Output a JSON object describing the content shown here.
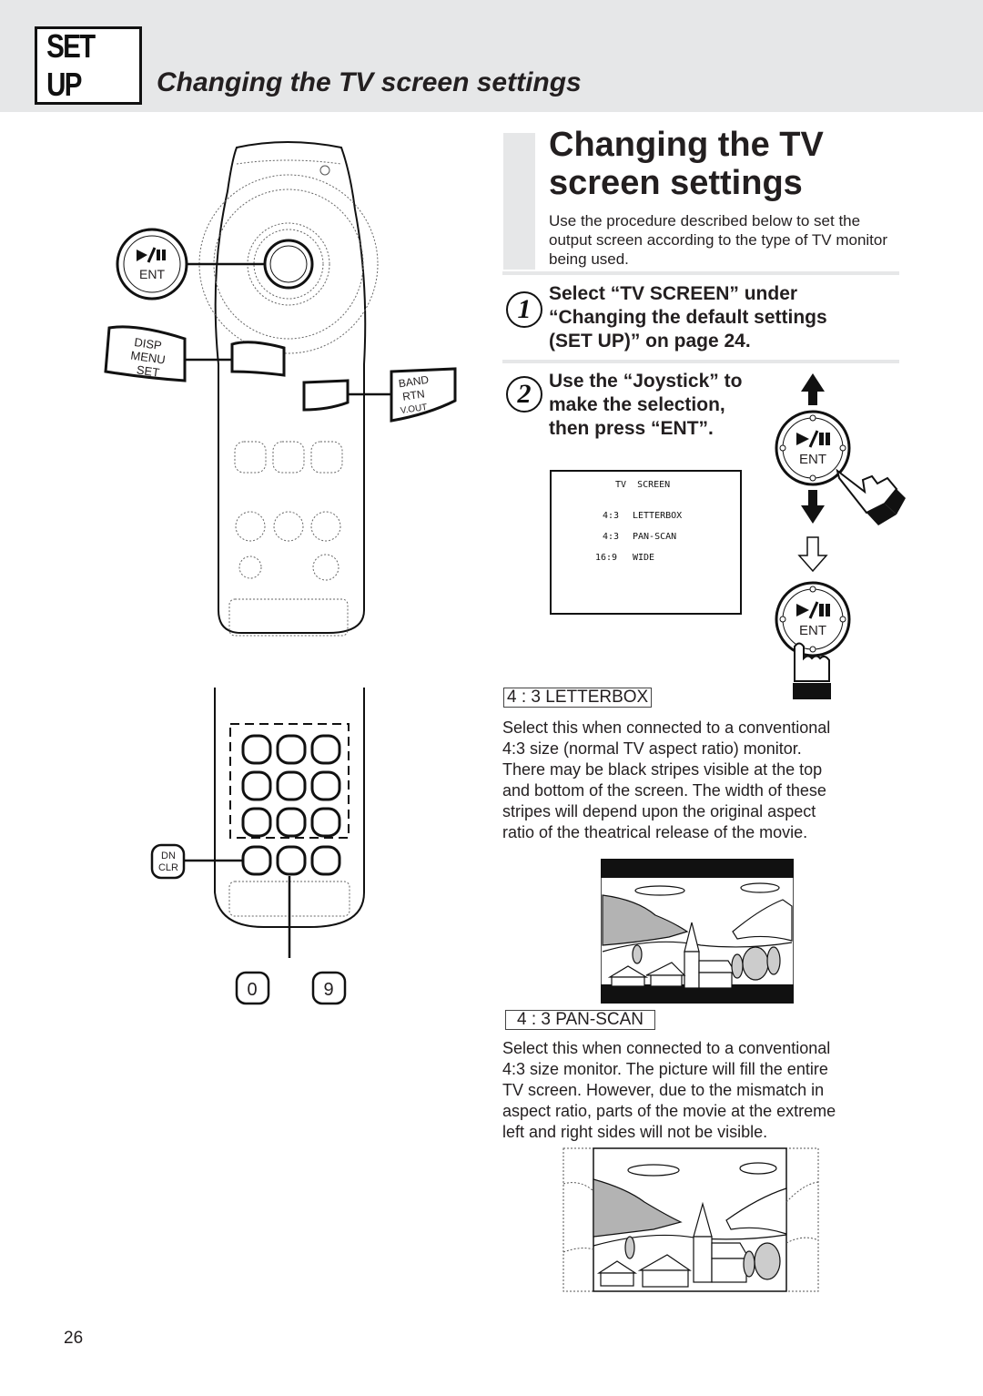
{
  "header": {
    "section_badge": "SET UP",
    "section_title": "Changing the TV screen settings",
    "band_color": "#e6e7e8"
  },
  "main": {
    "title_line1": "Changing the TV",
    "title_line2": "screen settings",
    "intro": "Use the procedure described below to set the output screen according to the type of TV monitor being used."
  },
  "steps": [
    {
      "number": "1",
      "lines": [
        "Select “TV SCREEN” under",
        "“Changing the default settings",
        "(SET UP)” on page 24."
      ]
    },
    {
      "number": "2",
      "lines": [
        "Use the “Joystick” to",
        "make the selection,",
        "then press “ENT”."
      ]
    }
  ],
  "osd_menu": {
    "title": "TV  SCREEN",
    "options": [
      {
        "ratio": "4:3",
        "label": "LETTERBOX"
      },
      {
        "ratio": "4:3",
        "label": "PAN-SCAN"
      },
      {
        "ratio": "16:9",
        "label": "WIDE"
      }
    ]
  },
  "remote": {
    "ent_button": {
      "symbol": "▶/❙❙",
      "label": "ENT"
    },
    "disp_button": {
      "labels": [
        "DISP",
        "MENU",
        "SET"
      ]
    },
    "band_button": {
      "labels": [
        "BAND",
        "RTN",
        "V.OUT"
      ]
    },
    "dn_clr_button": {
      "labels": [
        "DN",
        "CLR"
      ]
    },
    "number_keys": [
      "0",
      "9"
    ]
  },
  "joystick_diagram": {
    "ent_label": "ENT",
    "play_pause_symbol": "▶/❙❙"
  },
  "modes": [
    {
      "tag": "4 : 3 LETTERBOX",
      "lines": [
        "Select this when connected to a conventional",
        "4:3 size (normal TV aspect ratio) monitor.",
        "There may be black stripes visible at the top",
        "and bottom of the screen. The width of these",
        "stripes will depend upon the original aspect",
        "ratio of the theatrical release of the movie."
      ]
    },
    {
      "tag": "4 : 3 PAN-SCAN",
      "lines": [
        "Select this when connected to a conventional",
        "4:3 size monitor. The picture will fill the entire",
        "TV screen. However, due to the mismatch in",
        "aspect ratio, parts of the movie at the extreme",
        "left and right sides will not be visible."
      ]
    }
  ],
  "page_number": "26"
}
